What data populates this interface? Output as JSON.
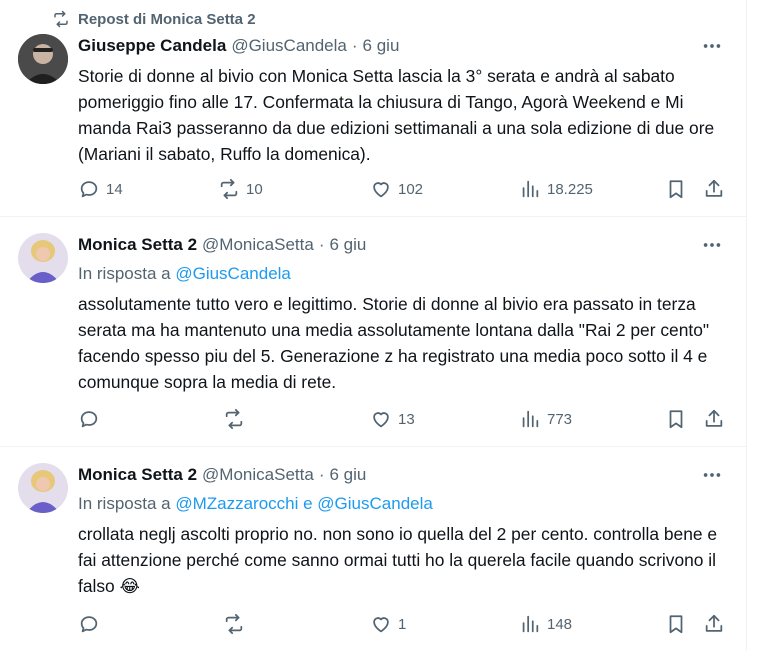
{
  "repost": {
    "label": "Repost di Monica Setta 2"
  },
  "tweets": [
    {
      "name": "Giuseppe Candela",
      "handle": "@GiusCandela",
      "dot": "·",
      "time": "6 giu",
      "text": "Storie di donne al bivio con Monica Setta lascia la 3° serata e andrà al sabato pomeriggio fino alle 17. Confermata la chiusura di Tango, Agorà Weekend e Mi manda Rai3 passeranno da due edizioni settimanali a una sola edizione di due ore (Mariani il sabato, Ruffo la domenica).",
      "replies": "14",
      "reposts": "10",
      "likes": "102",
      "views": "18.225"
    },
    {
      "name": "Monica Setta 2",
      "handle": "@MonicaSetta",
      "dot": "·",
      "time": "6 giu",
      "reply_prefix": "In risposta a",
      "reply_mention": "@GiusCandela",
      "text": "assolutamente tutto vero e legittimo. Storie di donne al bivio era passato in terza serata ma ha mantenuto una media assolutamente lontana dalla \"Rai 2 per cento\" facendo spesso piu del 5. Generazione z ha registrato una media poco sotto il 4 e comunque sopra la media di rete.",
      "replies": "",
      "reposts": "",
      "likes": "13",
      "views": "773"
    },
    {
      "name": "Monica Setta 2",
      "handle": "@MonicaSetta",
      "dot": "·",
      "time": "6 giu",
      "reply_prefix": "In risposta a",
      "reply_mention": "@MZazzarocchi e @GiusCandela",
      "text": "crollata neglj ascolti proprio no. non sono io quella del 2 per cento. controlla bene e fai attenzione perché come sanno ormai tutti ho la querela facile quando scrivono il falso",
      "emoji": "😂",
      "replies": "",
      "reposts": "",
      "likes": "1",
      "views": "148"
    }
  ],
  "colors": {
    "text": "#0f1419",
    "secondary": "#536471",
    "link": "#1d9bf0",
    "divider": "#eff3f4"
  }
}
